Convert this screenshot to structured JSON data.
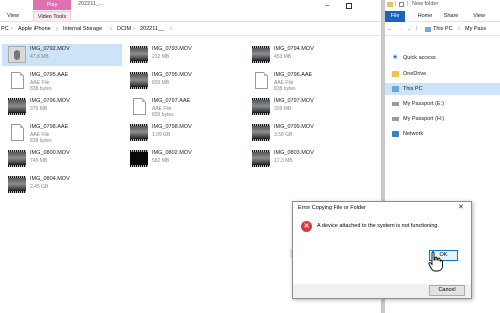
{
  "left_window": {
    "context_tab": "Play",
    "context_subtitle": "202211_...",
    "tabs": [
      "View",
      "Video Tools"
    ],
    "breadcrumb": [
      "PC",
      "Apple iPhone",
      "Internal Storage",
      "DCIM",
      "202211__"
    ]
  },
  "files": [
    {
      "name": "IMG_0792.MOV",
      "meta": "47.8 MB",
      "kind": "portrait",
      "selected": true
    },
    {
      "name": "IMG_0793.MOV",
      "meta": "232 MB",
      "kind": "video"
    },
    {
      "name": "IMG_0794.MOV",
      "meta": "453 MB",
      "kind": "video"
    },
    {
      "name": "IMG_0795.AAE",
      "meta": "AAE File",
      "meta2": "838 bytes",
      "kind": "aae"
    },
    {
      "name": "IMG_0795.MOV",
      "meta": "836 MB",
      "kind": "video"
    },
    {
      "name": "IMG_0796.AAE",
      "meta": "AAE File",
      "meta2": "838 bytes",
      "kind": "aae"
    },
    {
      "name": "IMG_0796.MOV",
      "meta": "375 MB",
      "kind": "video"
    },
    {
      "name": "IMG_0797.AAE",
      "meta": "AAE File",
      "meta2": "829 bytes",
      "kind": "aae"
    },
    {
      "name": "IMG_0797.MOV",
      "meta": "209 MB",
      "kind": "video"
    },
    {
      "name": "IMG_0798.AAE",
      "meta": "AAE File",
      "meta2": "838 bytes",
      "kind": "aae"
    },
    {
      "name": "IMG_0798.MOV",
      "meta": "1.09 GB",
      "kind": "video"
    },
    {
      "name": "IMG_0799.MOV",
      "meta": "3.58 GB",
      "kind": "video"
    },
    {
      "name": "IMG_0800.MOV",
      "meta": "745 MB",
      "kind": "video"
    },
    {
      "name": "IMG_0802.MOV",
      "meta": "582 MB",
      "kind": "dark"
    },
    {
      "name": "IMG_0803.MOV",
      "meta": "17.3 MB",
      "kind": "video"
    },
    {
      "name": "IMG_0804.MOV",
      "meta": "2.45 GB",
      "kind": "video"
    }
  ],
  "right_window": {
    "title": "New folder",
    "tabs": [
      "File",
      "Home",
      "Share",
      "View"
    ],
    "breadcrumb": [
      "This PC",
      "My Pass"
    ],
    "nav": [
      {
        "label": "Quick access",
        "icon": "star-icon",
        "selected": false
      },
      {
        "label": "OneDrive",
        "icon": "folder-icon",
        "selected": false
      },
      {
        "label": "This PC",
        "icon": "pc-icon",
        "selected": true
      },
      {
        "label": "My Passport (E:)",
        "icon": "drive-icon",
        "selected": false
      },
      {
        "label": "My Passport (H:)",
        "icon": "drive-icon",
        "selected": false
      },
      {
        "label": "Network",
        "icon": "network-icon",
        "selected": false
      }
    ]
  },
  "dialog": {
    "title": "Error Copying File or Folder",
    "message": "A device attached to the system is not functioning.",
    "ok_label": "OK",
    "cancel_label": "Cancel"
  },
  "colors": {
    "context_tab": "#e070b0",
    "file_tab": "#1a63b8",
    "selection": "#cde3f7",
    "error_red": "#d83b3b"
  }
}
